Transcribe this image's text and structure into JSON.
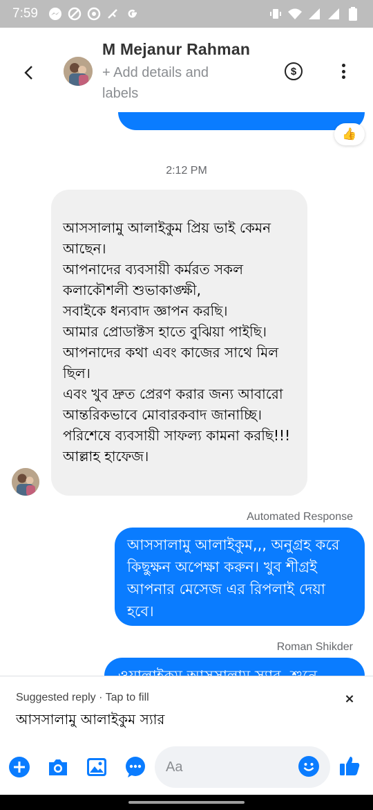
{
  "status_bar": {
    "time": "7:59",
    "left_icons": [
      "messenger-icon",
      "blocked-icon",
      "app-icon",
      "call-icon",
      "google-icon"
    ],
    "right_icons": [
      "vibrate-icon",
      "wifi-icon",
      "signal-icon",
      "signal-icon",
      "battery-icon"
    ]
  },
  "header": {
    "name": "M Mejanur Rahman",
    "subtitle": "+ Add details and labels",
    "payment_symbol": "$"
  },
  "conversation": {
    "reaction": "👍",
    "timestamp": "2:12 PM",
    "incoming_message": "আসসালামু আলাইকুম প্রিয় ভাই কেমন আছেন।\nআপনাদের ব্যবসায়ী কর্মরত সকল কলাকৌশলী শুভাকাঙ্ক্ষী,\nসবাইকে ধন্যবাদ জ্ঞাপন করছি।\nআমার প্রোডাক্টস হাতে বুঝিয়া পাইছি।\nআপনাদের কথা এবং কাজের সাথে মিল ছিল।\nএবং খুব দ্রুত প্রেরণ করার জন্য আবারো আন্তরিকভাবে মোবারকবাদ জানাচ্ছি।\nপরিশেষে ব্যবসায়ী সাফল্য কামনা করছি!!!\nআল্লাহ হাফেজ।",
    "auto_label": "Automated Response",
    "auto_message": "আসসালামু আলাইকুম,,, অনুগ্রহ করে কিছুক্ষন অপেক্ষা করুন। খুব শীগ্রই আপনার মেসেজ এর রিপলাই দেয়া হবে।",
    "sender_label": "Roman Shikder",
    "partial_message": "ওয়ালাইকুম আসসালাম স্যার, শুনে"
  },
  "suggested_reply": {
    "label": "Suggested reply · Tap to fill",
    "text": "আসসালামু আলাইকুম স্যার",
    "close": "×"
  },
  "composer": {
    "placeholder": "Aa"
  },
  "colors": {
    "accent": "#0a7cff",
    "incoming_bubble": "#f0f0f0",
    "status_bar": "#bdbdbd"
  }
}
